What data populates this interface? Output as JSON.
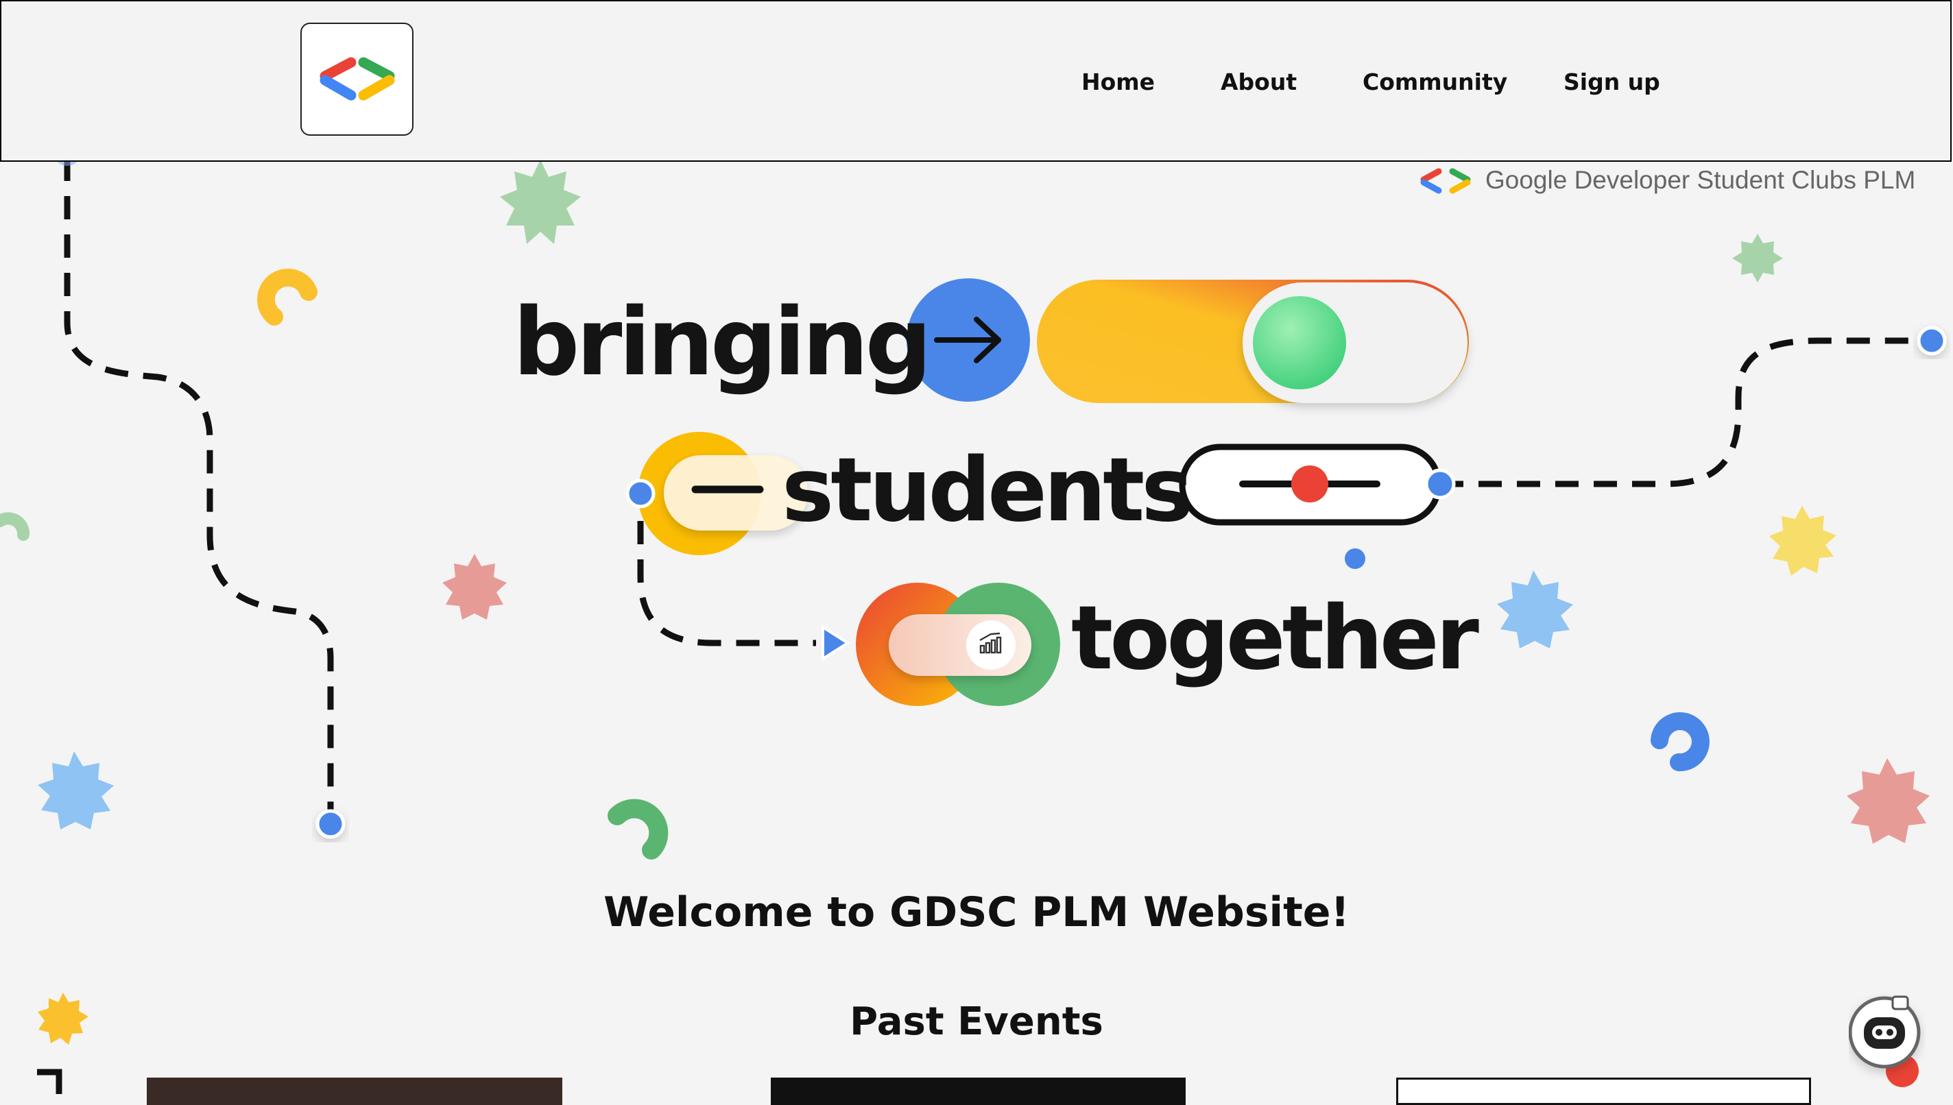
{
  "nav": {
    "links": [
      "Home",
      "About",
      "Community",
      "Sign up"
    ]
  },
  "hero": {
    "brand_tag": "Google Developer Student Clubs PLM",
    "words": [
      "bringing",
      "students",
      "together"
    ]
  },
  "welcome_heading": "Welcome to GDSC PLM Website!",
  "past_events_heading": "Past Events",
  "colors": {
    "google_blue": "#4a86e8",
    "google_red": "#ea4335",
    "google_yellow": "#fbbc04",
    "google_green": "#34a853"
  },
  "icons": [
    "gdsc-logo-icon",
    "arrow-right-icon",
    "chart-icon",
    "chat-bot-icon"
  ]
}
